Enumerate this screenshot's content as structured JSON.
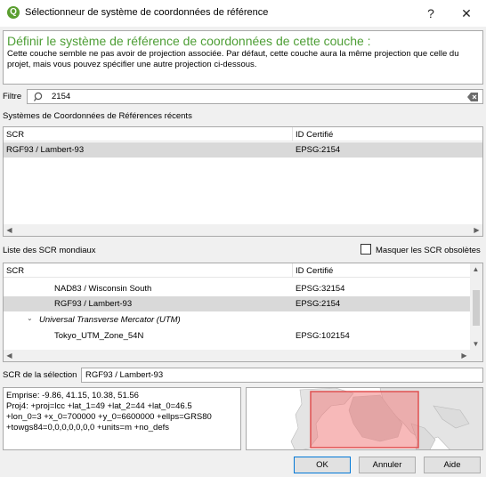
{
  "window": {
    "title": "Sélectionneur de système de coordonnées de référence",
    "icon": "qgis-icon",
    "help_glyph": "?",
    "close_glyph": "✕"
  },
  "info": {
    "heading": "Définir le système de référence de coordonnées de cette couche :",
    "text": "Cette couche semble ne pas avoir de projection associée. Par défaut, cette couche aura la même projection que celle du projet, mais vous pouvez spécifier une autre projection ci-dessous."
  },
  "filter": {
    "label": "Filtre",
    "value": "2154"
  },
  "recent": {
    "section_label": "Systèmes de Coordonnées de Références récents",
    "columns": [
      "SCR",
      "ID Certifié"
    ],
    "rows": [
      {
        "name": "RGF93 / Lambert-93",
        "id": "EPSG:2154",
        "selected": true
      }
    ]
  },
  "world": {
    "section_label": "Liste des SCR mondiaux",
    "hide_obsolete_label": "Masquer les SCR obsolètes",
    "hide_obsolete_checked": false,
    "columns": [
      "SCR",
      "ID Certifié"
    ],
    "rows": [
      {
        "name": "NAD83 / Wisconsin South",
        "id": "EPSG:32154"
      },
      {
        "name": "RGF93 / Lambert-93",
        "id": "EPSG:2154",
        "selected": true
      },
      {
        "group": "Universal Transverse Mercator (UTM)"
      },
      {
        "name": "Tokyo_UTM_Zone_54N",
        "id": "EPSG:102154"
      }
    ]
  },
  "selection": {
    "label": "SCR de la sélection",
    "value": "RGF93 / Lambert-93"
  },
  "details": {
    "lines": [
      "Emprise: -9.86, 41.15, 10.38, 51.56",
      "Proj4: +proj=lcc +lat_1=49 +lat_2=44 +lat_0=46.5",
      "+lon_0=3 +x_0=700000 +y_0=6600000 +ellps=GRS80",
      "+towgs84=0,0,0,0,0,0,0 +units=m +no_defs"
    ]
  },
  "buttons": {
    "ok": "OK",
    "cancel": "Annuler",
    "help": "Aide"
  },
  "colors": {
    "accent_green": "#4d9e35",
    "selection_row": "#d9d9d9",
    "extent_fill": "#f08080"
  }
}
